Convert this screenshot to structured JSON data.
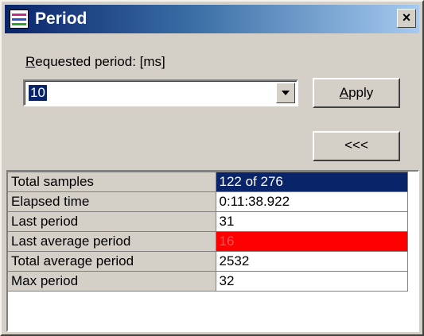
{
  "window": {
    "title": "Period",
    "icon": "chart-icon",
    "close_label": "×"
  },
  "controls": {
    "requested_label_prefix": "R",
    "requested_label_rest": "equested period: [ms]",
    "requested_value": "10",
    "apply_prefix": "A",
    "apply_rest": "pply",
    "back_label": "<<<"
  },
  "stats": [
    {
      "name": "Total samples",
      "value": "122 of 276",
      "state": "selected"
    },
    {
      "name": "Elapsed time",
      "value": "0:11:38.922",
      "state": "normal"
    },
    {
      "name": "Last period",
      "value": "31",
      "state": "normal"
    },
    {
      "name": "Last average period",
      "value": "16",
      "state": "alert"
    },
    {
      "name": "Total average period",
      "value": "2532",
      "state": "normal"
    },
    {
      "name": "Max period",
      "value": "32",
      "state": "normal"
    }
  ],
  "colors": {
    "title_start": "#0a246a",
    "title_end": "#a6caf0",
    "selection": "#0a246a",
    "alert": "#ff0000",
    "face": "#d4d0c8"
  }
}
